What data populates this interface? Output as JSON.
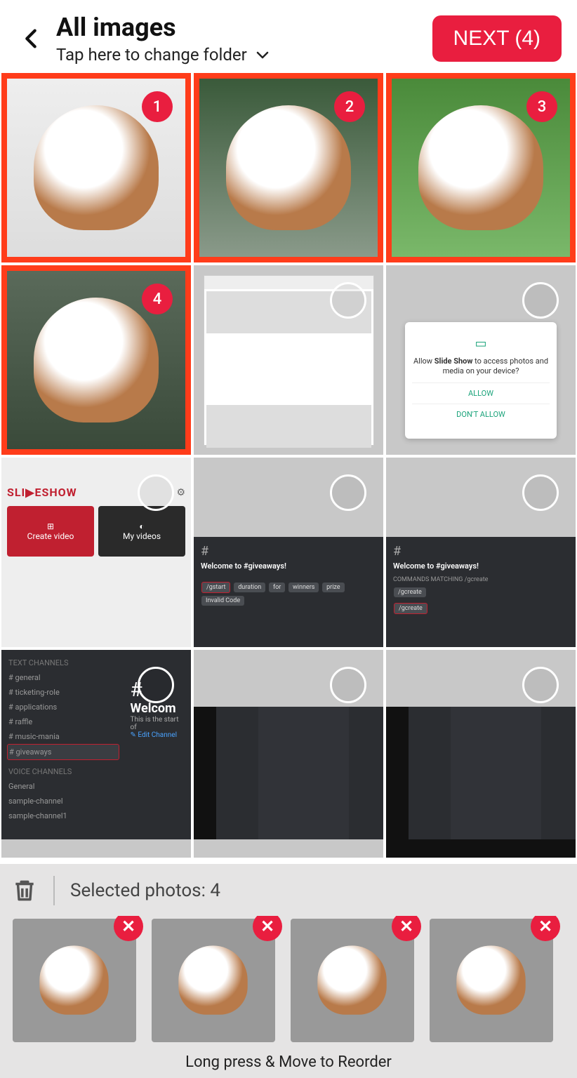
{
  "header": {
    "title": "All images",
    "subtitle": "Tap here to change folder",
    "next_label": "NEXT (4)"
  },
  "grid": {
    "selected_badges": [
      "1",
      "2",
      "3",
      "4"
    ],
    "dialog": {
      "text_pre": "Allow ",
      "text_bold": "Slide Show",
      "text_post": " to access photos and media on your device?",
      "allow": "ALLOW",
      "deny": "DON'T ALLOW"
    },
    "slideshow": {
      "logo": "SLI▶ESHOW",
      "create": "Create video",
      "myvideos": "My videos"
    },
    "discord": {
      "hash": "#",
      "welcome_title": "Welcome to #giveaways!",
      "cmd_gcreate": "/gcreate",
      "pills": [
        "/gstart",
        "duration",
        "for",
        "winners",
        "|",
        "prize",
        "Invalid Code"
      ],
      "channels_header": "TEXT CHANNELS",
      "channels": [
        "# general",
        "# ticketing-role",
        "# applications",
        "# raffle",
        "# music-mania",
        "# giveaways"
      ],
      "voice_header": "VOICE CHANNELS",
      "voice": [
        "General",
        "sample-channel",
        "sample-channel1"
      ],
      "welcome_big": "Welcom",
      "welcome_sub": "This is the start of",
      "welcome_link": "✎ Edit Channel"
    }
  },
  "tray": {
    "label_prefix": "Selected photos: ",
    "count": "4",
    "hint": "Long press & Move to Reorder"
  }
}
